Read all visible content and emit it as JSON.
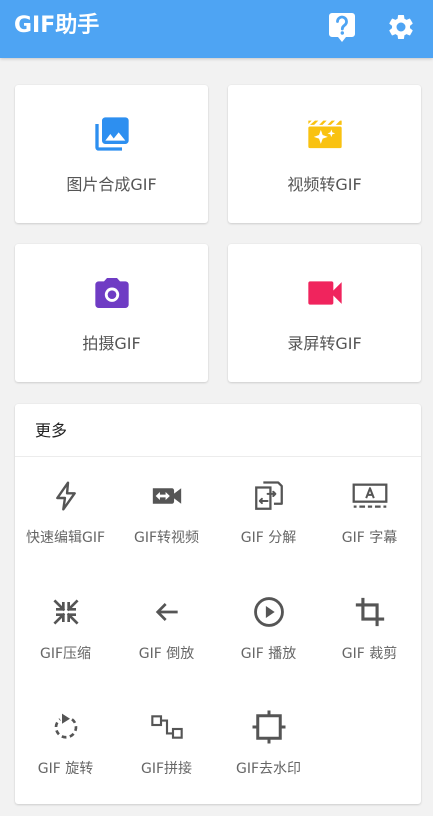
{
  "appbar": {
    "title": "GIF助手",
    "help_icon": "help-icon",
    "settings_icon": "gear-icon",
    "color": "#4ea4f3"
  },
  "cards": [
    {
      "label": "图片合成GIF",
      "icon": "photo-library-icon",
      "color": "#2d8ff0"
    },
    {
      "label": "视频转GIF",
      "icon": "movie-sparkle-icon",
      "color": "#f9c211"
    },
    {
      "label": "拍摄GIF",
      "icon": "camera-icon",
      "color": "#6f3cc4"
    },
    {
      "label": "录屏转GIF",
      "icon": "videocam-icon",
      "color": "#f0245d"
    }
  ],
  "more": {
    "title": "更多",
    "tools": [
      {
        "label": "快速编辑GIF",
        "icon": "flash-icon"
      },
      {
        "label": "GIF转视频",
        "icon": "gif-to-video-icon"
      },
      {
        "label": "GIF 分解",
        "icon": "split-file-icon"
      },
      {
        "label": "GIF 字幕",
        "icon": "subtitle-icon"
      },
      {
        "label": "GIF压缩",
        "icon": "compress-icon"
      },
      {
        "label": "GIF 倒放",
        "icon": "arrow-left-icon"
      },
      {
        "label": "GIF 播放",
        "icon": "play-circle-icon"
      },
      {
        "label": "GIF 裁剪",
        "icon": "crop-icon"
      },
      {
        "label": "GIF 旋转",
        "icon": "rotate-icon"
      },
      {
        "label": "GIF拼接",
        "icon": "join-icon"
      },
      {
        "label": "GIF去水印",
        "icon": "remove-watermark-icon"
      }
    ]
  }
}
